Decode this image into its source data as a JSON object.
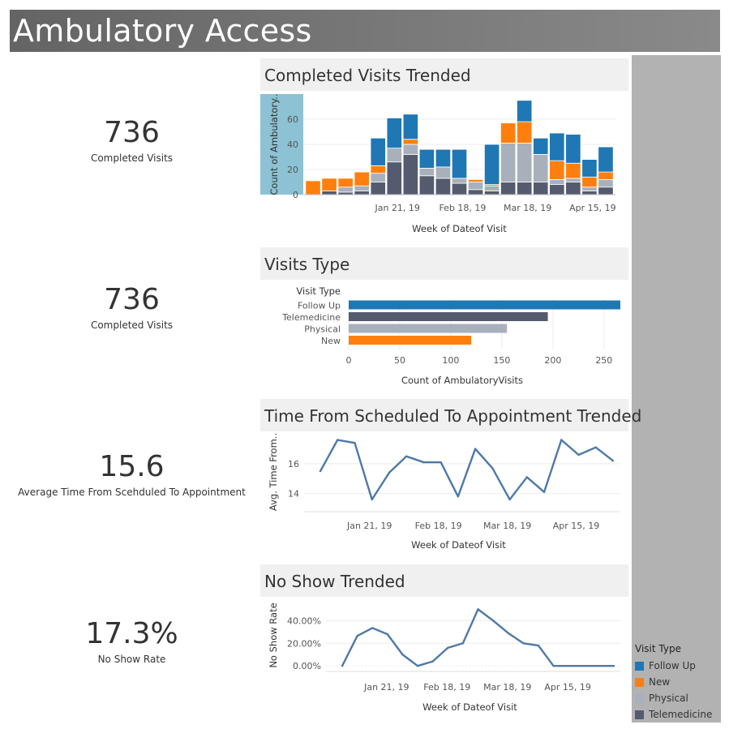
{
  "header": {
    "title": "Ambulatory Access"
  },
  "kpis": [
    {
      "value": "736",
      "label": "Completed Visits"
    },
    {
      "value": "736",
      "label": "Completed Visits"
    },
    {
      "value": "15.6",
      "label": "Average Time From Scehduled To Appointment"
    },
    {
      "value": "17.3%",
      "label": "No Show Rate"
    }
  ],
  "panels": {
    "completed": {
      "title": "Completed Visits Trended"
    },
    "types": {
      "title": "Visits Type"
    },
    "time": {
      "title": "Time From Scheduled To Appointment Trended"
    },
    "noshow": {
      "title": "No Show Trended"
    }
  },
  "colors": {
    "Follow Up": "#1f77b4",
    "New": "#ff7f0e",
    "Physical": "#a8b0bc",
    "Telemedicine": "#555b6e",
    "line": "#4e79a7"
  },
  "legend": {
    "title": "Visit Type",
    "items": [
      "Follow Up",
      "New",
      "Physical",
      "Telemedicine"
    ]
  },
  "chart_data": [
    {
      "type": "bar",
      "stacked": true,
      "title": "Completed Visits Trended",
      "xlabel": "Week of Dateof Visit",
      "ylabel": "Count of Ambulatory..",
      "ylim": [
        0,
        80
      ],
      "yticks": [
        0,
        20,
        40,
        60
      ],
      "xtick_labels": [
        {
          "index": 3,
          "label": "Jan 21, 19"
        },
        {
          "index": 7,
          "label": "Feb 18, 19"
        },
        {
          "index": 11,
          "label": "Mar 18, 19"
        },
        {
          "index": 15,
          "label": "Apr 15, 19"
        }
      ],
      "series": [
        {
          "name": "Telemedicine",
          "values": [
            0,
            3,
            2,
            3,
            10,
            26,
            32,
            15,
            13,
            9,
            4,
            3,
            10,
            10,
            10,
            8,
            10,
            3,
            6
          ]
        },
        {
          "name": "Physical",
          "values": [
            0,
            0,
            4,
            4,
            7,
            11,
            8,
            6,
            9,
            4,
            6,
            4,
            31,
            31,
            22,
            4,
            3,
            3,
            6
          ]
        },
        {
          "name": "New",
          "values": [
            11,
            10,
            7,
            11,
            6,
            0,
            4,
            0,
            0,
            0,
            2,
            1,
            16,
            17,
            0,
            15,
            12,
            8,
            6
          ]
        },
        {
          "name": "Follow Up",
          "values": [
            0,
            0,
            0,
            0,
            22,
            24,
            20,
            15,
            14,
            23,
            0,
            32,
            0,
            17,
            13,
            22,
            23,
            14,
            20
          ]
        }
      ]
    },
    {
      "type": "bar",
      "orientation": "horizontal",
      "title": "Visits Type",
      "category_header": "Visit Type",
      "categories": [
        "Follow Up",
        "Telemedicine",
        "Physical",
        "New"
      ],
      "values": [
        266,
        195,
        155,
        120
      ],
      "xlabel": "Count of AmbulatoryVisits",
      "xlim": [
        0,
        270
      ],
      "xticks": [
        0,
        50,
        100,
        150,
        200,
        250
      ]
    },
    {
      "type": "line",
      "title": "Time From Scheduled To Appointment Trended",
      "xlabel": "Week of Dateof Visit",
      "ylabel": "Avg. Time From..",
      "ylim": [
        13.0,
        17.9
      ],
      "yticks": [
        14,
        16
      ],
      "xtick_labels": [
        {
          "index": 3,
          "label": "Jan 21, 19"
        },
        {
          "index": 7,
          "label": "Feb 18, 19"
        },
        {
          "index": 11,
          "label": "Mar 18, 19"
        },
        {
          "index": 15,
          "label": "Apr 15, 19"
        }
      ],
      "values": [
        15.5,
        17.6,
        17.4,
        13.6,
        15.4,
        16.5,
        16.1,
        16.1,
        13.8,
        17.0,
        15.7,
        13.6,
        15.1,
        14.1,
        17.6,
        16.6,
        17.1,
        16.2
      ]
    },
    {
      "type": "line",
      "title": "No Show Trended",
      "xlabel": "Week of Dateof Visit",
      "ylabel": "No Show Rate",
      "ylim": [
        -0.02,
        0.56
      ],
      "yticks": [
        0,
        0.2,
        0.4
      ],
      "ytick_labels": [
        "0.00%",
        "20.00%",
        "40.00%"
      ],
      "xtick_labels": [
        {
          "index": 3,
          "label": "Jan 21, 19"
        },
        {
          "index": 7,
          "label": "Feb 18, 19"
        },
        {
          "index": 11,
          "label": "Mar 18, 19"
        },
        {
          "index": 15,
          "label": "Apr 15, 19"
        }
      ],
      "values": [
        0.0,
        0.265,
        0.335,
        0.28,
        0.1,
        0.0,
        0.04,
        0.16,
        0.2,
        0.5,
        0.4,
        0.29,
        0.2,
        0.18,
        0.0,
        0.0,
        0.0,
        0.0,
        0.0
      ]
    }
  ]
}
